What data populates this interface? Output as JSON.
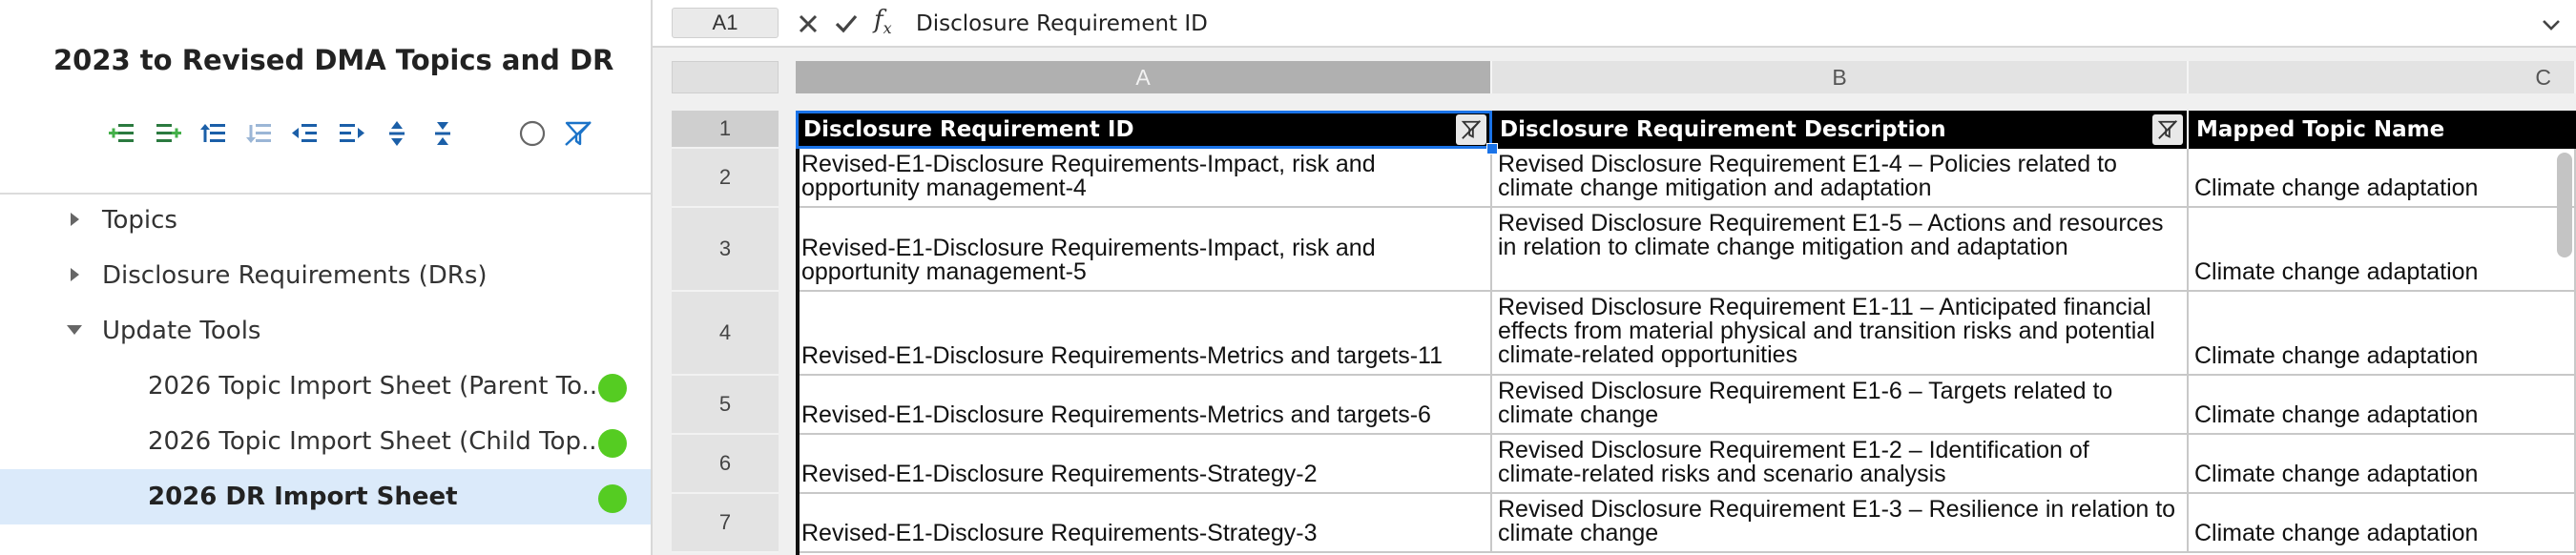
{
  "sidebar": {
    "title": "2023 to Revised DMA Topics and DR ...",
    "toolbar": [
      {
        "icon": "add-child-icon"
      },
      {
        "icon": "add-sibling-icon"
      },
      {
        "icon": "move-up-icon"
      },
      {
        "icon": "move-down-icon"
      },
      {
        "icon": "outdent-icon"
      },
      {
        "icon": "indent-icon"
      },
      {
        "icon": "expand-all-icon"
      },
      {
        "icon": "collapse-all-icon"
      },
      {
        "icon": "circle-icon"
      },
      {
        "icon": "filter-off-icon"
      }
    ],
    "tree": [
      {
        "label": "Topics",
        "state": "collapsed"
      },
      {
        "label": "Disclosure Requirements (DRs)",
        "state": "collapsed"
      },
      {
        "label": "Update Tools",
        "state": "expanded"
      },
      {
        "label": "2026 Topic Import Sheet (Parent To...",
        "status": "green"
      },
      {
        "label": "2026 Topic Import Sheet (Child Top...",
        "status": "green"
      },
      {
        "label": "2026 DR Import Sheet",
        "status": "green",
        "selected": true
      }
    ]
  },
  "formula_bar": {
    "cell_ref": "A1",
    "fx": "f",
    "fx_sub": "x",
    "value": "Disclosure Requirement ID"
  },
  "columns": [
    "A",
    "B",
    "C"
  ],
  "rows": [
    "1",
    "2",
    "3",
    "4",
    "5",
    "6",
    "7"
  ],
  "header": [
    "Disclosure Requirement ID",
    "Disclosure Requirement Description",
    "Mapped Topic Name"
  ],
  "data": [
    [
      "Revised-E1-Disclosure Requirements-Impact, risk and opportunity management-4",
      "Revised Disclosure Requirement E1-4 – Policies related to climate change mitigation and adaptation",
      "Climate change adaptation"
    ],
    [
      "Revised-E1-Disclosure Requirements-Impact, risk and opportunity management-5",
      "Revised Disclosure Requirement E1-5 – Actions and resources in relation to climate change mitigation and adaptation",
      "Climate change adaptation"
    ],
    [
      "Revised-E1-Disclosure Requirements-Metrics and targets-11",
      "Revised Disclosure Requirement E1-11 – Anticipated financial effects from material physical and transition risks and potential climate-related opportunities",
      "Climate change adaptation"
    ],
    [
      "Revised-E1-Disclosure Requirements-Metrics and targets-6",
      "Revised Disclosure Requirement E1-6 – Targets related to climate change",
      "Climate change adaptation"
    ],
    [
      "Revised-E1-Disclosure Requirements-Strategy-2",
      "Revised Disclosure Requirement E1-2 – Identification of climate-related risks and scenario analysis",
      "Climate change adaptation"
    ],
    [
      "Revised-E1-Disclosure Requirements-Strategy-3",
      "Revised Disclosure Requirement E1-3 – Resilience in relation to climate change",
      "Climate change adaptation"
    ]
  ],
  "colors": {
    "accent": "#1a73e8",
    "status_green": "#55cc22",
    "selected_bg": "#dbeafa",
    "header_bg": "#000000"
  }
}
